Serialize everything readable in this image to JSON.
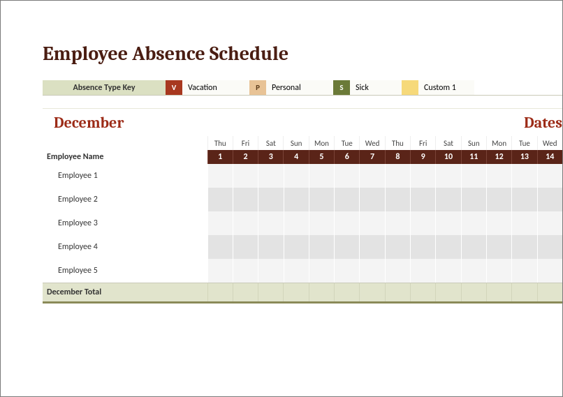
{
  "title": "Employee Absence Schedule",
  "key": {
    "label": "Absence Type Key",
    "items": [
      {
        "code": "V",
        "text": "Vacation"
      },
      {
        "code": "P",
        "text": "Personal"
      },
      {
        "code": "S",
        "text": "Sick"
      },
      {
        "code": "",
        "text": "Custom 1"
      }
    ]
  },
  "schedule": {
    "month": "December",
    "dates_label": "Dates",
    "employee_header": "Employee Name",
    "days_of_week": [
      "Thu",
      "Fri",
      "Sat",
      "Sun",
      "Mon",
      "Tue",
      "Wed",
      "Thu",
      "Fri",
      "Sat",
      "Sun",
      "Mon",
      "Tue",
      "Wed"
    ],
    "day_numbers": [
      "1",
      "2",
      "3",
      "4",
      "5",
      "6",
      "7",
      "8",
      "9",
      "10",
      "11",
      "12",
      "13",
      "14"
    ],
    "employees": [
      "Employee 1",
      "Employee 2",
      "Employee 3",
      "Employee 4",
      "Employee 5"
    ],
    "total_label": "December Total"
  }
}
